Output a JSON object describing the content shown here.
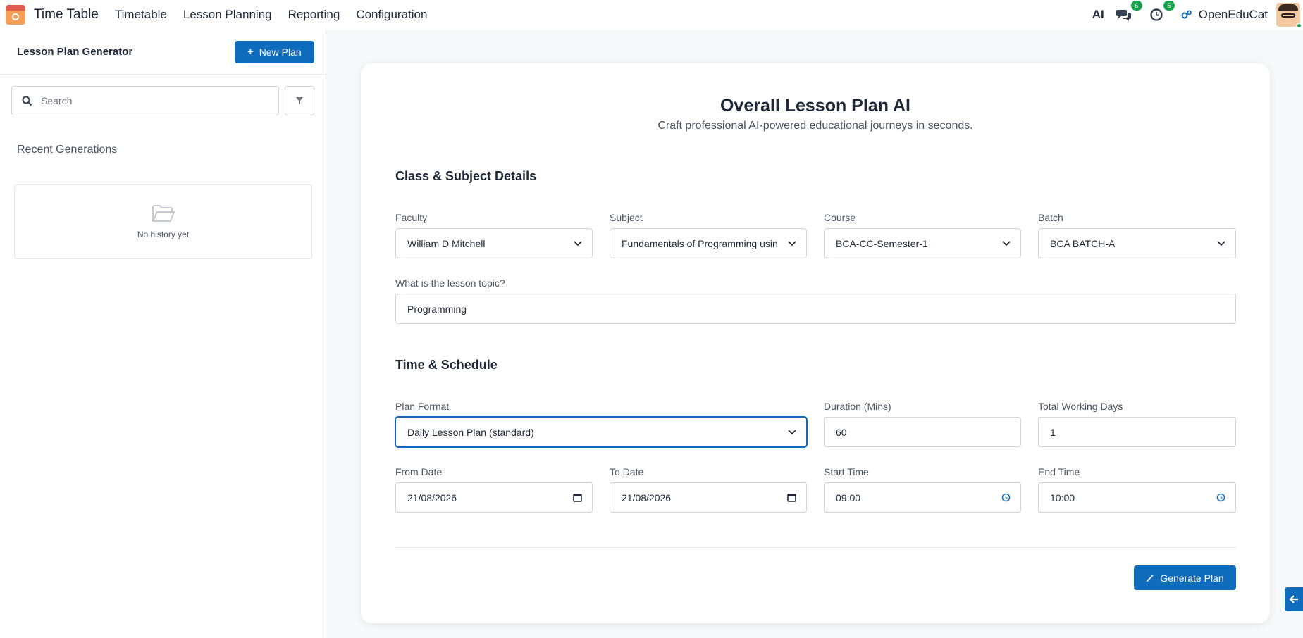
{
  "navbar": {
    "app_name": "Time Table",
    "menu": [
      {
        "label": "Timetable"
      },
      {
        "label": "Lesson Planning"
      },
      {
        "label": "Reporting"
      },
      {
        "label": "Configuration"
      }
    ],
    "ai_label": "AI",
    "messages_count": "6",
    "activities_count": "5",
    "company_name": "OpenEduCat"
  },
  "sidebar": {
    "title": "Lesson Plan Generator",
    "new_plan_label": "New Plan",
    "search_placeholder": "Search",
    "recent_title": "Recent Generations",
    "empty_text": "No history yet"
  },
  "form": {
    "title": "Overall Lesson Plan AI",
    "subtitle": "Craft professional AI-powered educational journeys in seconds.",
    "section_class": "Class & Subject Details",
    "faculty": {
      "label": "Faculty",
      "value": "William D Mitchell"
    },
    "subject": {
      "label": "Subject",
      "value": "Fundamentals of Programming usin"
    },
    "course": {
      "label": "Course",
      "value": "BCA-CC-Semester-1"
    },
    "batch": {
      "label": "Batch",
      "value": "BCA BATCH-A"
    },
    "topic": {
      "label": "What is the lesson topic?",
      "value": "Programming"
    },
    "section_time": "Time & Schedule",
    "plan_format": {
      "label": "Plan Format",
      "value": "Daily Lesson Plan (standard)"
    },
    "duration": {
      "label": "Duration (Mins)",
      "value": "60"
    },
    "working_days": {
      "label": "Total Working Days",
      "value": "1"
    },
    "from_date": {
      "label": "From Date",
      "value": "21/08/2026"
    },
    "to_date": {
      "label": "To Date",
      "value": "21/08/2026"
    },
    "start_time": {
      "label": "Start Time",
      "value": "09:00"
    },
    "end_time": {
      "label": "End Time",
      "value": "10:00"
    },
    "generate_label": "Generate Plan"
  },
  "colors": {
    "primary": "#0f6cbd",
    "badge": "#16a34a"
  }
}
